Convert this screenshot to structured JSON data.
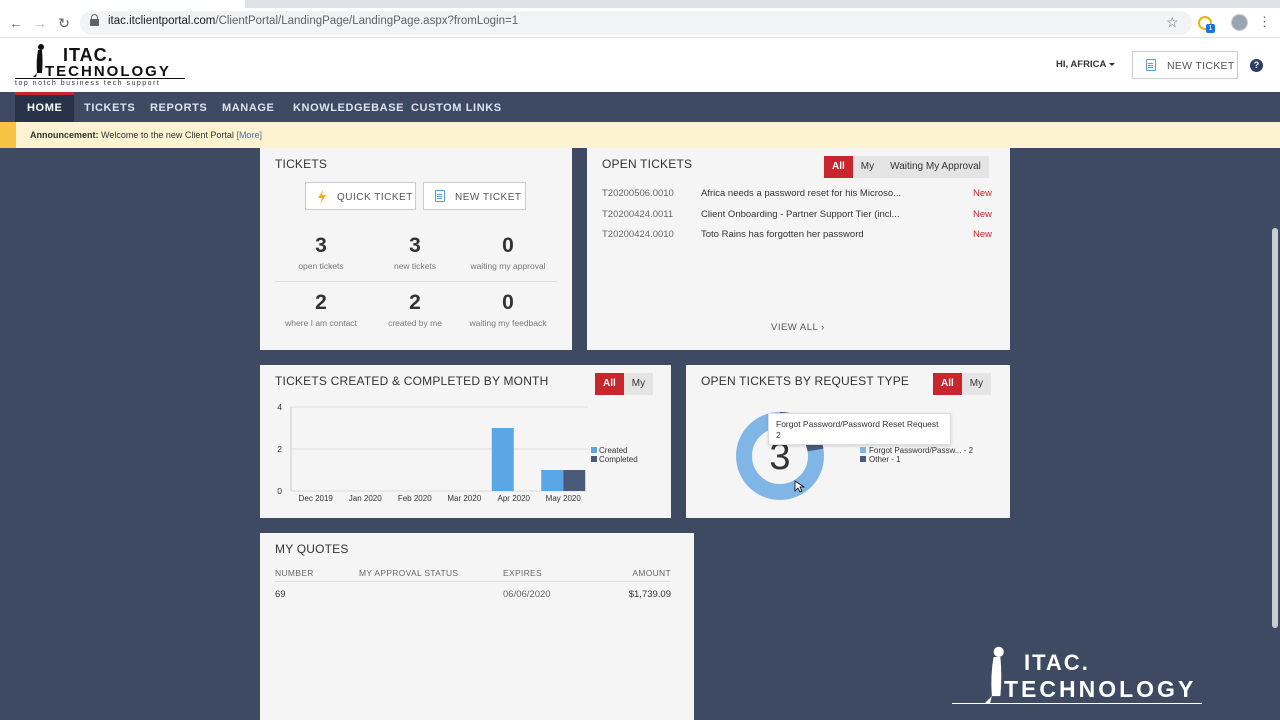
{
  "browser": {
    "url_host": "itac.itclientportal.com",
    "url_path": "/ClientPortal/LandingPage/LandingPage.aspx?fromLogin=1",
    "ext_badge": "1"
  },
  "header": {
    "logo_line1": "ITAC.",
    "logo_line2": "TECHNOLOGY",
    "logo_tagline": "top notch business tech support",
    "greeting": "HI, AFRICA",
    "new_ticket_label": "NEW TICKET",
    "help_glyph": "?"
  },
  "nav": {
    "items": [
      {
        "label": "HOME",
        "active": true
      },
      {
        "label": "TICKETS"
      },
      {
        "label": "REPORTS"
      },
      {
        "label": "MANAGE"
      },
      {
        "label": "KNOWLEDGEBASE"
      },
      {
        "label": "CUSTOM LINKS"
      }
    ]
  },
  "announcement": {
    "label": "Announcement:",
    "text": "Welcome to the new Client Portal",
    "more": "[More]"
  },
  "tickets_panel": {
    "title": "TICKETS",
    "quick_ticket": "QUICK TICKET",
    "new_ticket": "NEW TICKET",
    "stats": [
      {
        "num": "3",
        "cap": "open tickets"
      },
      {
        "num": "3",
        "cap": "new tickets"
      },
      {
        "num": "0",
        "cap": "waiting my approval"
      },
      {
        "num": "2",
        "cap": "where I am contact"
      },
      {
        "num": "2",
        "cap": "created by me"
      },
      {
        "num": "0",
        "cap": "waiting my feedback"
      }
    ]
  },
  "open_tickets": {
    "title": "OPEN TICKETS",
    "filters": [
      "All",
      "My",
      "Waiting My Approval"
    ],
    "rows": [
      {
        "id": "T20200506.0010",
        "subject": "Africa needs a password reset for his Microso...",
        "status": "New"
      },
      {
        "id": "T20200424.0011",
        "subject": "Client Onboarding - Partner Support Tier (incl...",
        "status": "New"
      },
      {
        "id": "T20200424.0010",
        "subject": "Toto Rains has forgotten her password",
        "status": "New"
      }
    ],
    "view_all": "VIEW ALL"
  },
  "created_completed": {
    "title": "TICKETS CREATED & COMPLETED BY MONTH",
    "filters": [
      "All",
      "My"
    ]
  },
  "request_type": {
    "title": "OPEN TICKETS BY REQUEST TYPE",
    "filters": [
      "All",
      "My"
    ],
    "center_value": "3",
    "tooltip_title": "Forgot Password/Password Reset Request",
    "tooltip_value": "2",
    "legend": [
      {
        "label": "Forgot Password/Passw... - 2",
        "color": "#7fb6e6"
      },
      {
        "label": "Other - 1",
        "color": "#4a5a78"
      }
    ]
  },
  "quotes": {
    "title": "MY QUOTES",
    "headers": [
      "NUMBER",
      "MY APPROVAL STATUS",
      "EXPIRES",
      "AMOUNT"
    ],
    "rows": [
      {
        "number": "69",
        "status": "",
        "expires": "06/06/2020",
        "amount": "$1,739.09"
      }
    ]
  },
  "watermark": {
    "line1": "ITAC.",
    "line2": "TECHNOLOGY"
  },
  "chart_data": {
    "type": "bar",
    "categories": [
      "Dec 2019",
      "Jan 2020",
      "Feb 2020",
      "Mar 2020",
      "Apr 2020",
      "May 2020"
    ],
    "series": [
      {
        "name": "Created",
        "values": [
          0,
          0,
          0,
          0,
          3,
          1
        ],
        "color": "#5ba7e6"
      },
      {
        "name": "Completed",
        "values": [
          0,
          0,
          0,
          0,
          0,
          1
        ],
        "color": "#4a5a78"
      }
    ],
    "ylim": [
      0,
      4
    ],
    "yticks": [
      "0",
      "2",
      "4"
    ],
    "legend_position": "right"
  }
}
